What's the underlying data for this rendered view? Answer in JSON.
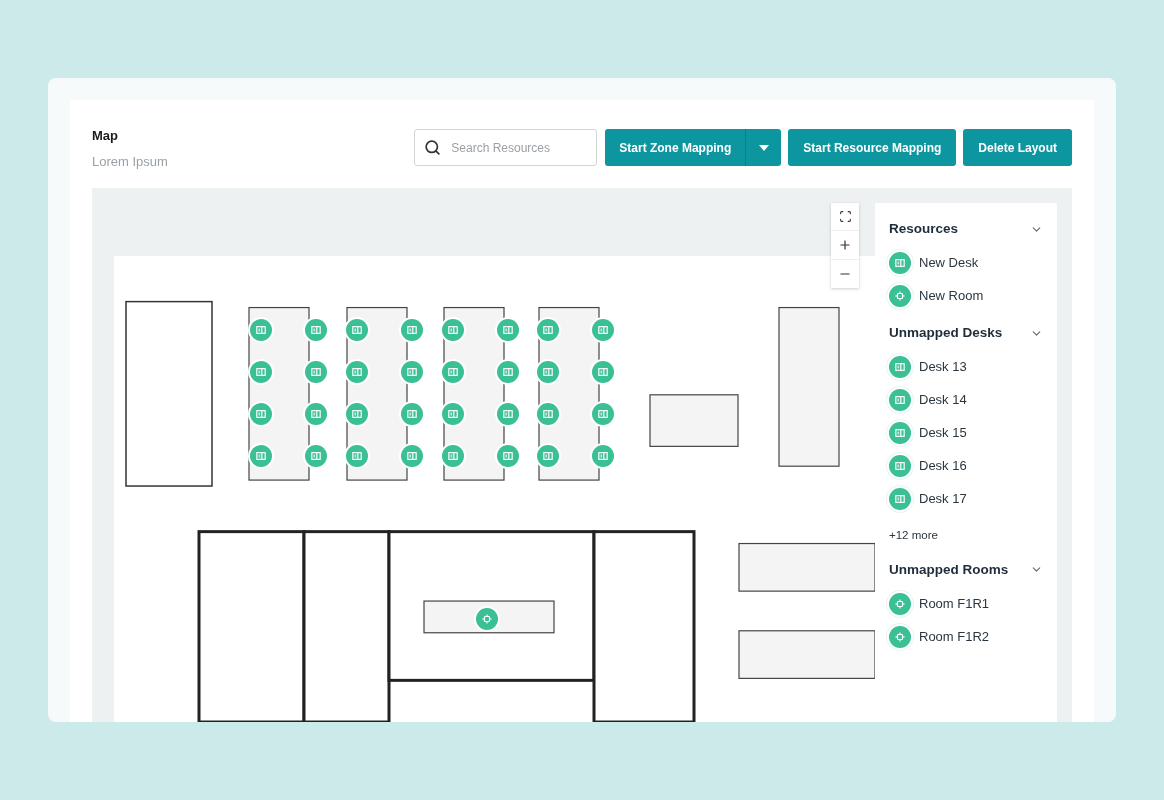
{
  "header": {
    "title": "Map",
    "subtitle": "Lorem Ipsum"
  },
  "search": {
    "placeholder": "Search Resources"
  },
  "buttons": [
    {
      "label": "Start Zone Mapping",
      "kind": "split"
    },
    {
      "label": "Start Resource Mapping",
      "kind": "plain"
    },
    {
      "label": "Delete Layout",
      "kind": "plain"
    }
  ],
  "sections": [
    {
      "title": "Resources",
      "expanded": true,
      "items": [
        {
          "label": "New Desk",
          "kind": "desk"
        },
        {
          "label": "New Room",
          "kind": "room"
        }
      ]
    },
    {
      "title": "Unmapped Desks",
      "expanded": true,
      "items": [
        {
          "label": "Desk 13",
          "kind": "desk"
        },
        {
          "label": "Desk 14",
          "kind": "desk"
        },
        {
          "label": "Desk 15",
          "kind": "desk"
        },
        {
          "label": "Desk 16",
          "kind": "desk"
        },
        {
          "label": "Desk 17",
          "kind": "desk"
        }
      ],
      "more": "+12 more"
    },
    {
      "title": "Unmapped Rooms",
      "expanded": true,
      "items": [
        {
          "label": "Room F1R1",
          "kind": "room"
        },
        {
          "label": "Room F1R2",
          "kind": "room"
        }
      ]
    }
  ]
}
